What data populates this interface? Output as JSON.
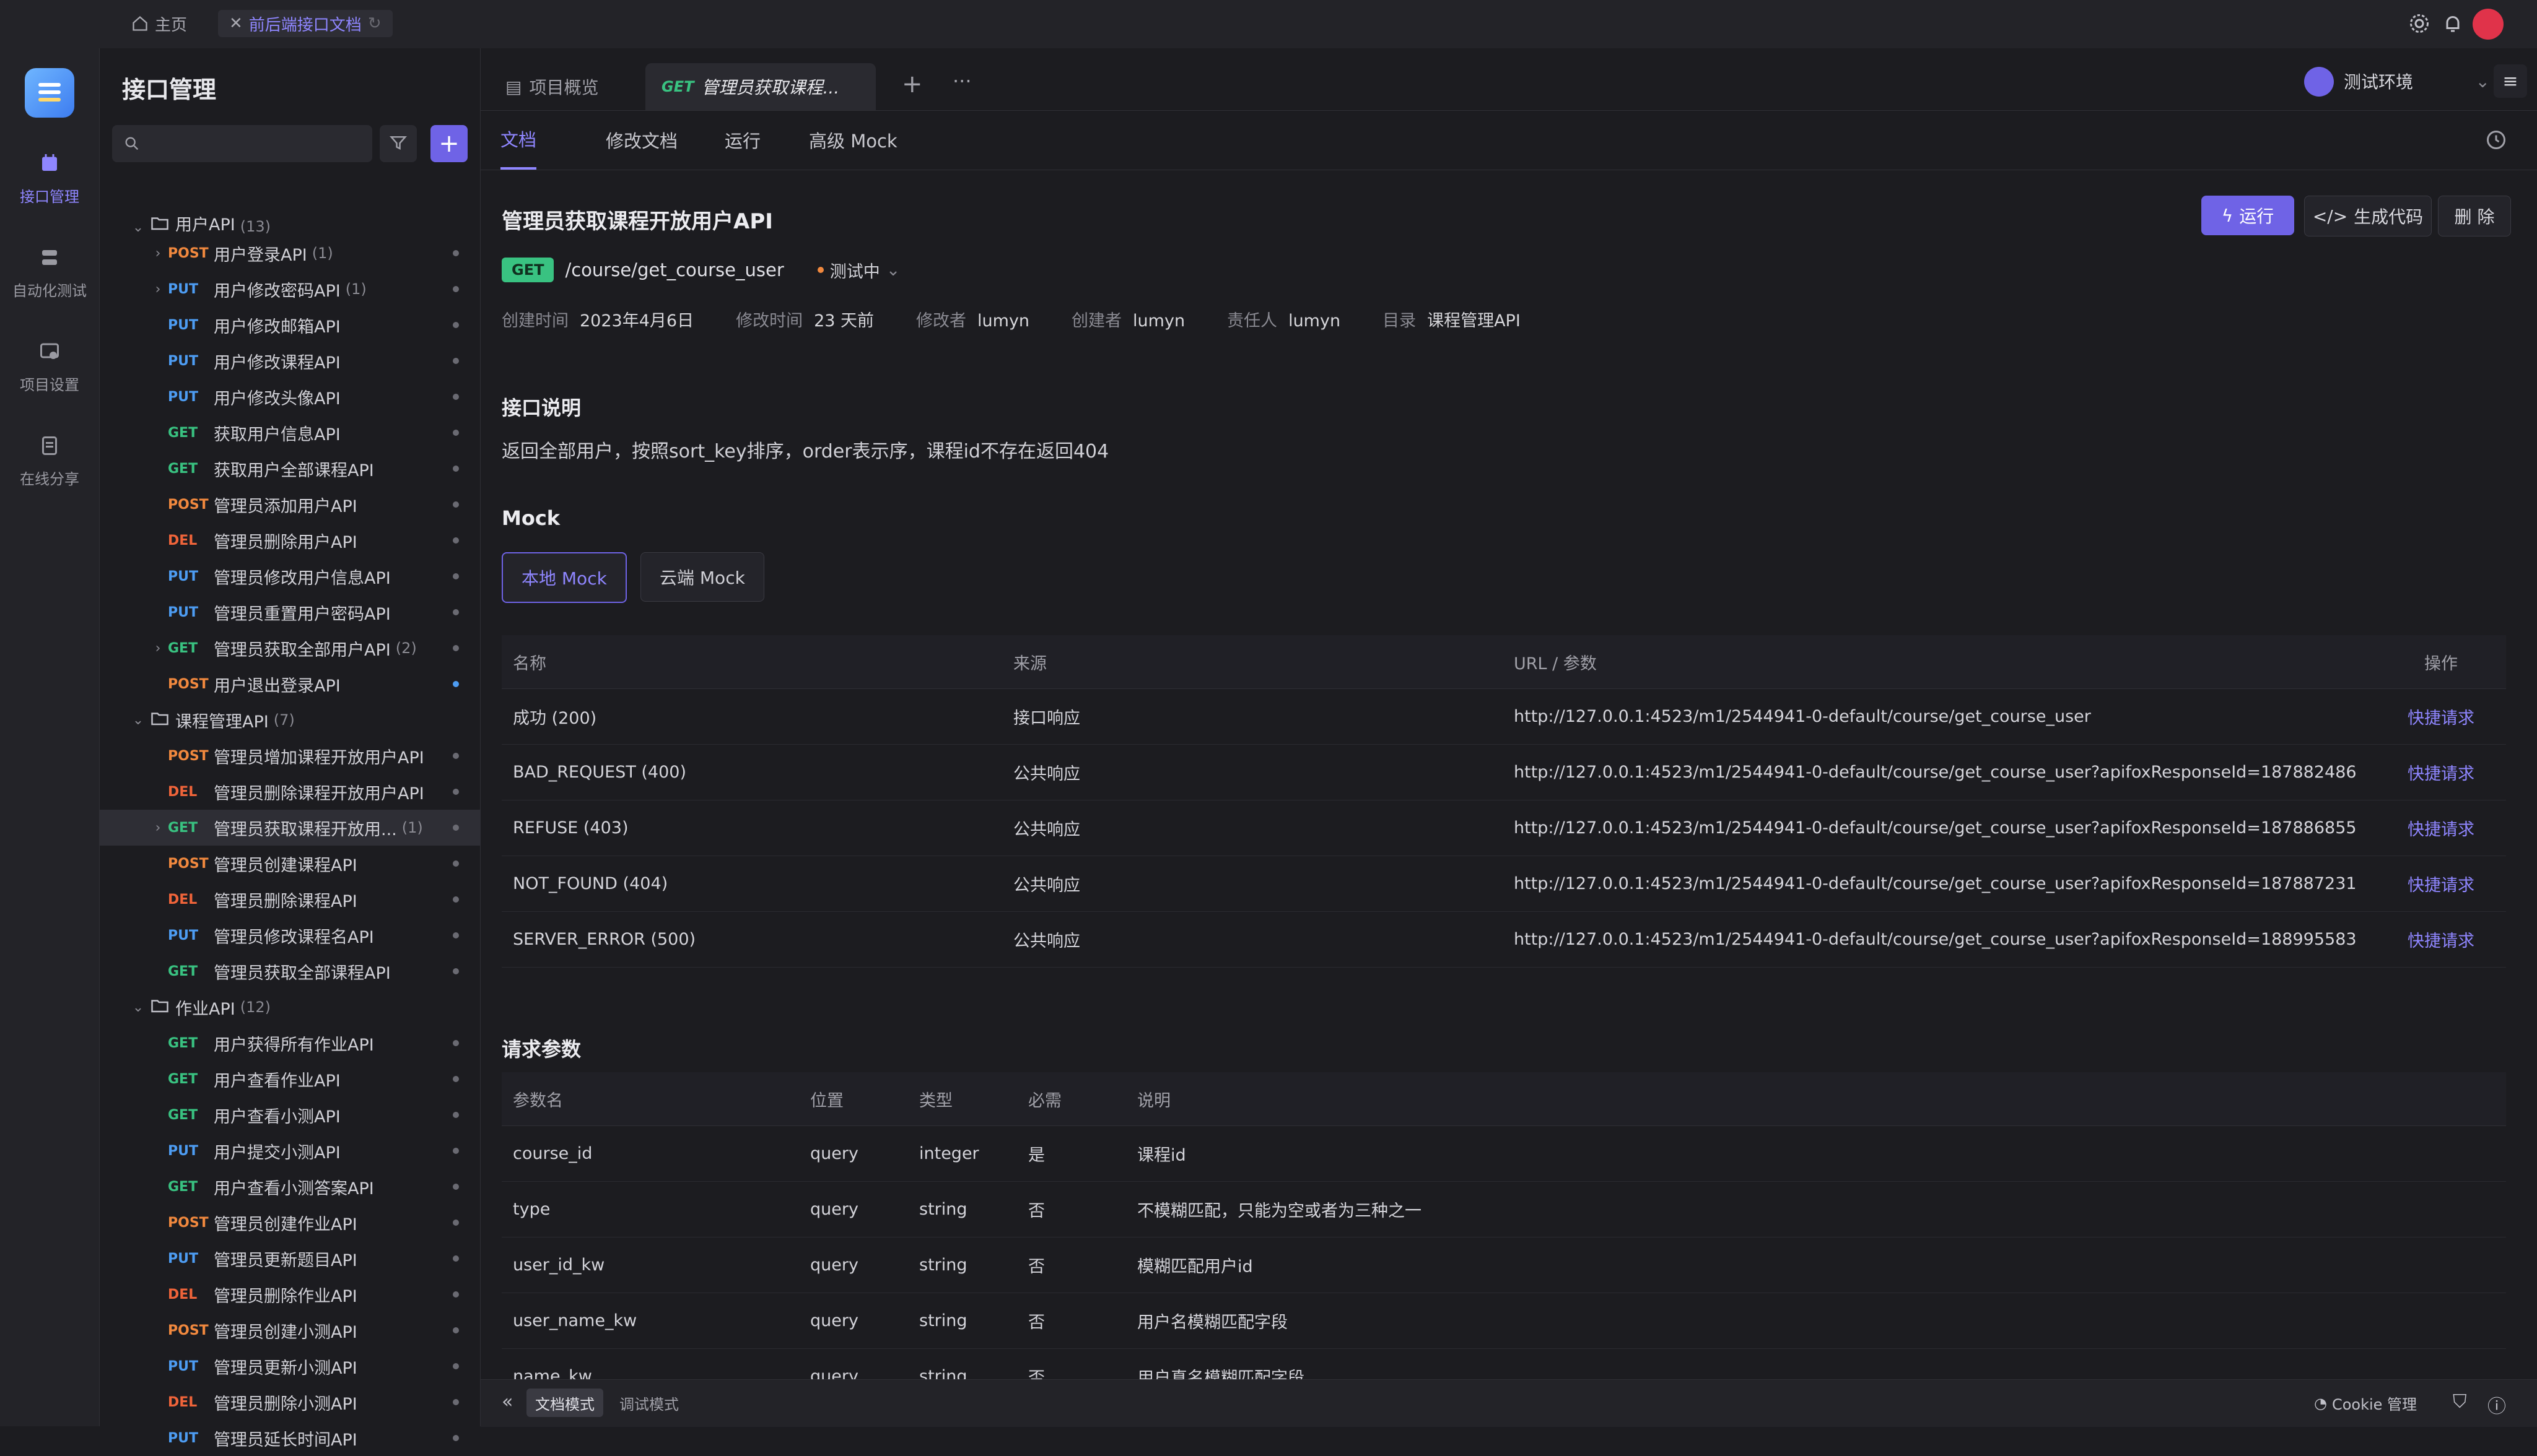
{
  "topbar": {
    "home_label": "主页",
    "doc_tab_label": "前后端接口文档"
  },
  "rail": {
    "items": [
      {
        "label": "接口管理",
        "icon": "api-icon",
        "active": true
      },
      {
        "label": "自动化测试",
        "icon": "automation-icon"
      },
      {
        "label": "项目设置",
        "icon": "settings-icon"
      },
      {
        "label": "在线分享",
        "icon": "share-icon"
      }
    ]
  },
  "sidebar": {
    "title": "接口管理",
    "search_placeholder": "",
    "tree": [
      {
        "kind": "folder",
        "label": "用户API",
        "count": "(13)",
        "partial": true
      },
      {
        "method": "POST",
        "label": "用户登录API",
        "count": "(1)",
        "expandable": true
      },
      {
        "method": "PUT",
        "label": "用户修改密码API",
        "count": "(1)",
        "expandable": true
      },
      {
        "method": "PUT",
        "label": "用户修改邮箱API"
      },
      {
        "method": "PUT",
        "label": "用户修改课程API"
      },
      {
        "method": "PUT",
        "label": "用户修改头像API"
      },
      {
        "method": "GET",
        "label": "获取用户信息API"
      },
      {
        "method": "GET",
        "label": "获取用户全部课程API"
      },
      {
        "method": "POST",
        "label": "管理员添加用户API"
      },
      {
        "method": "DEL",
        "label": "管理员删除用户API"
      },
      {
        "method": "PUT",
        "label": "管理员修改用户信息API"
      },
      {
        "method": "PUT",
        "label": "管理员重置用户密码API"
      },
      {
        "method": "GET",
        "label": "管理员获取全部用户API",
        "count": "(2)",
        "expandable": true
      },
      {
        "method": "POST",
        "label": "用户退出登录API",
        "dot": "blue"
      },
      {
        "kind": "folder",
        "label": "课程管理API",
        "count": "(7)"
      },
      {
        "method": "POST",
        "label": "管理员增加课程开放用户API"
      },
      {
        "method": "DEL",
        "label": "管理员删除课程开放用户API"
      },
      {
        "method": "GET",
        "label": "管理员获取课程开放用...",
        "count": "(1)",
        "expandable": true,
        "selected": true
      },
      {
        "method": "POST",
        "label": "管理员创建课程API"
      },
      {
        "method": "DEL",
        "label": "管理员删除课程API"
      },
      {
        "method": "PUT",
        "label": "管理员修改课程名API"
      },
      {
        "method": "GET",
        "label": "管理员获取全部课程API"
      },
      {
        "kind": "folder",
        "label": "作业API",
        "count": "(12)"
      },
      {
        "method": "GET",
        "label": "用户获得所有作业API"
      },
      {
        "method": "GET",
        "label": "用户查看作业API"
      },
      {
        "method": "GET",
        "label": "用户查看小测API"
      },
      {
        "method": "PUT",
        "label": "用户提交小测API"
      },
      {
        "method": "GET",
        "label": "用户查看小测答案API"
      },
      {
        "method": "POST",
        "label": "管理员创建作业API"
      },
      {
        "method": "PUT",
        "label": "管理员更新题目API"
      },
      {
        "method": "DEL",
        "label": "管理员删除作业API"
      },
      {
        "method": "POST",
        "label": "管理员创建小测API"
      },
      {
        "method": "PUT",
        "label": "管理员更新小测API"
      },
      {
        "method": "DEL",
        "label": "管理员删除小测API"
      },
      {
        "method": "PUT",
        "label": "管理员延长时间API"
      }
    ]
  },
  "file_tabs": {
    "overview": "项目概览",
    "active_method": "GET",
    "active_label": "管理员获取课程...",
    "env": "测试环境"
  },
  "sub_tabs": [
    "文档",
    "修改文档",
    "运行",
    "高级 Mock"
  ],
  "api": {
    "title": "管理员获取课程开放用户API",
    "method": "GET",
    "path": "/course/get_course_user",
    "status": "测试中",
    "run_label": "运行",
    "gen_code_label": "生成代码",
    "delete_label": "删 除",
    "meta": [
      {
        "k": "创建时间",
        "v": "2023年4月6日"
      },
      {
        "k": "修改时间",
        "v": "23 天前"
      },
      {
        "k": "修改者",
        "v": "lumyn"
      },
      {
        "k": "创建者",
        "v": "lumyn"
      },
      {
        "k": "责任人",
        "v": "lumyn"
      },
      {
        "k": "目录",
        "v": "课程管理API"
      }
    ]
  },
  "desc": {
    "heading": "接口说明",
    "text": "返回全部用户，按照sort_key排序，order表示序，课程id不存在返回404"
  },
  "mock": {
    "heading": "Mock",
    "tabs": [
      "本地 Mock",
      "云端 Mock"
    ],
    "headers": [
      "名称",
      "来源",
      "URL / 参数",
      "操作"
    ],
    "rows": [
      [
        "成功 (200)",
        "接口响应",
        "http://127.0.0.1:4523/m1/2544941-0-default/course/get_course_user",
        "快捷请求"
      ],
      [
        "BAD_REQUEST (400)",
        "公共响应",
        "http://127.0.0.1:4523/m1/2544941-0-default/course/get_course_user?apifoxResponseId=187882486",
        "快捷请求"
      ],
      [
        "REFUSE (403)",
        "公共响应",
        "http://127.0.0.1:4523/m1/2544941-0-default/course/get_course_user?apifoxResponseId=187886855",
        "快捷请求"
      ],
      [
        "NOT_FOUND (404)",
        "公共响应",
        "http://127.0.0.1:4523/m1/2544941-0-default/course/get_course_user?apifoxResponseId=187887231",
        "快捷请求"
      ],
      [
        "SERVER_ERROR (500)",
        "公共响应",
        "http://127.0.0.1:4523/m1/2544941-0-default/course/get_course_user?apifoxResponseId=188995583",
        "快捷请求"
      ]
    ]
  },
  "params": {
    "heading": "请求参数",
    "headers": [
      "参数名",
      "位置",
      "类型",
      "必需",
      "说明"
    ],
    "rows": [
      [
        "course_id",
        "query",
        "integer",
        "是",
        "课程id"
      ],
      [
        "type",
        "query",
        "string",
        "否",
        "不模糊匹配，只能为空或者为三种之一"
      ],
      [
        "user_id_kw",
        "query",
        "string",
        "否",
        "模糊匹配用户id"
      ],
      [
        "user_name_kw",
        "query",
        "string",
        "否",
        "用户名模糊匹配字段"
      ],
      [
        "name_kw",
        "query",
        "string",
        "否",
        "用户真名模糊匹配字段"
      ]
    ]
  },
  "bottombar": {
    "doc_mode": "文档模式",
    "debug_mode": "调试模式",
    "cookie": "Cookie 管理"
  },
  "colors": {
    "accent": "#8f86ff",
    "post": "#f0883e",
    "put": "#4d9cf2",
    "get": "#39c281",
    "del": "#f0643a"
  }
}
